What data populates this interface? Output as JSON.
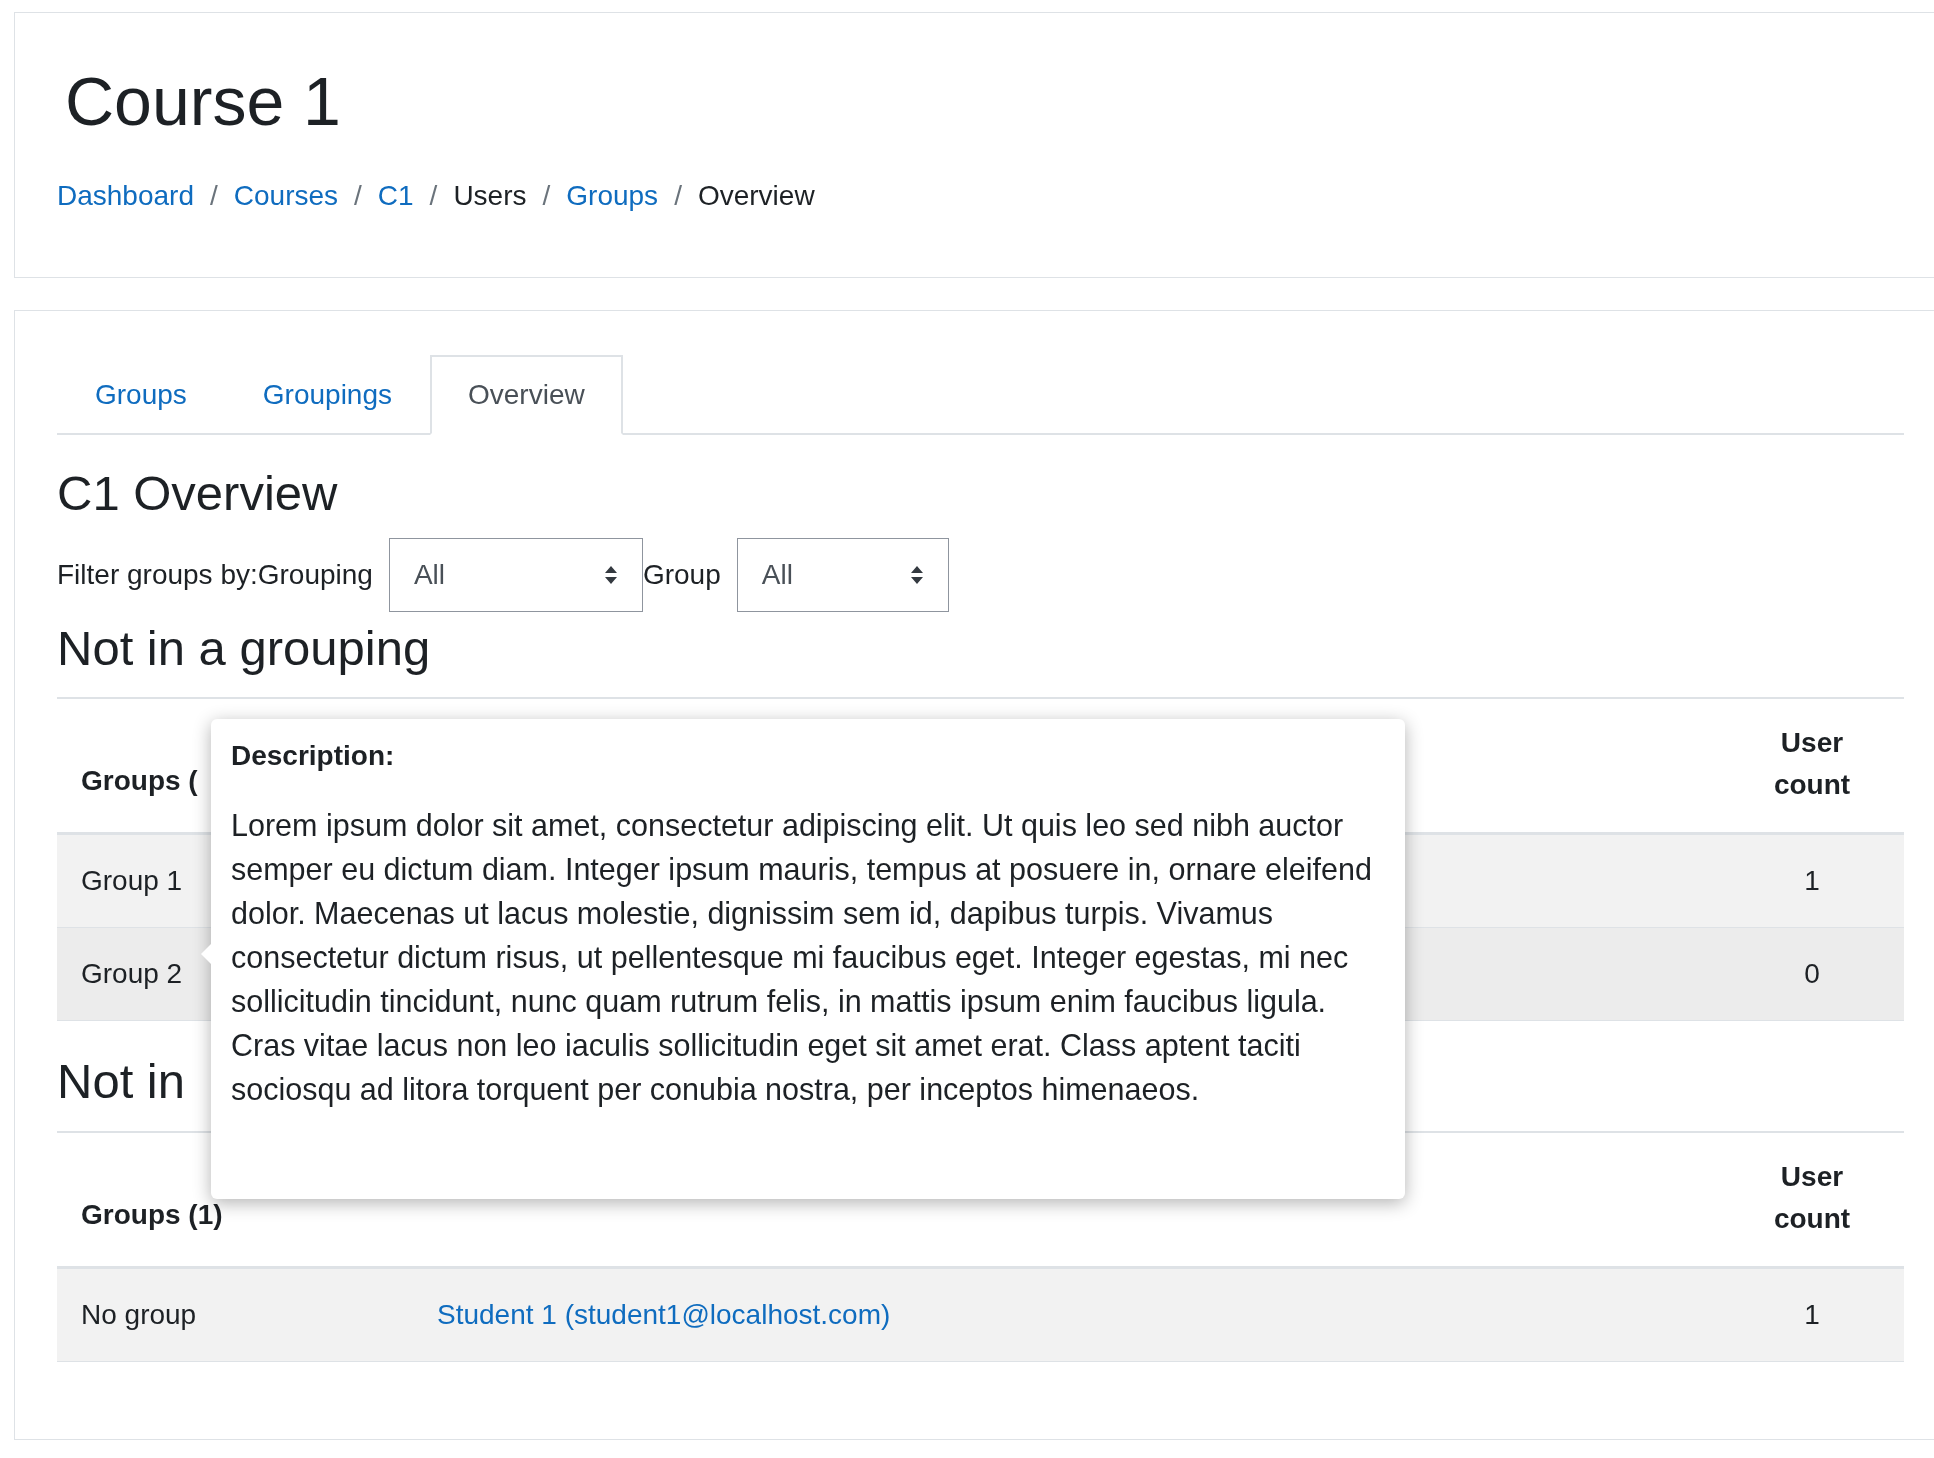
{
  "page_title": "Course 1",
  "breadcrumb": [
    {
      "label": "Dashboard",
      "kind": "link"
    },
    {
      "label": "Courses",
      "kind": "link"
    },
    {
      "label": "C1",
      "kind": "link"
    },
    {
      "label": "Users",
      "kind": "text"
    },
    {
      "label": "Groups",
      "kind": "link"
    },
    {
      "label": "Overview",
      "kind": "text"
    }
  ],
  "separator": "/",
  "tabs": [
    {
      "label": "Groups",
      "selected": false
    },
    {
      "label": "Groupings",
      "selected": false
    },
    {
      "label": "Overview",
      "selected": true
    }
  ],
  "heading": "C1 Overview",
  "filter": {
    "label": "Filter groups by:",
    "grouping_label": "Grouping",
    "grouping_value": "All",
    "group_label": "Group",
    "group_value": "All"
  },
  "sections": [
    {
      "heading": "Not in a grouping",
      "columns": [
        "Groups (",
        "",
        "User count"
      ],
      "rows": [
        {
          "cells": [
            "Group 1",
            "",
            "1"
          ]
        },
        {
          "cells": [
            "Group 2",
            "",
            "0"
          ]
        }
      ]
    },
    {
      "heading": "Not in",
      "columns": [
        "Groups (1)",
        "",
        "User count"
      ],
      "rows": [
        {
          "cells": [
            "No group",
            "Student 1 (student1@localhost.com)",
            "1"
          ]
        }
      ]
    }
  ],
  "tooltip": {
    "title": "Description:",
    "text": "Lorem ipsum dolor sit amet, consectetur adipiscing elit. Ut quis leo sed nibh auctor semper eu dictum diam. Integer ipsum mauris, tempus at posuere in, ornare eleifend dolor. Maecenas ut lacus molestie, dignissim sem id, dapibus turpis. Vivamus consectetur dictum risus, ut pellentesque mi faucibus eget. Integer egestas, mi nec sollicitudin tincidunt, nunc quam rutrum felis, in mattis ipsum enim faucibus ligula. Cras vitae lacus non leo iaculis sollicitudin eget sit amet erat. Class aptent taciti sociosqu ad litora torquent per conubia nostra, per inceptos himenaeos."
  }
}
